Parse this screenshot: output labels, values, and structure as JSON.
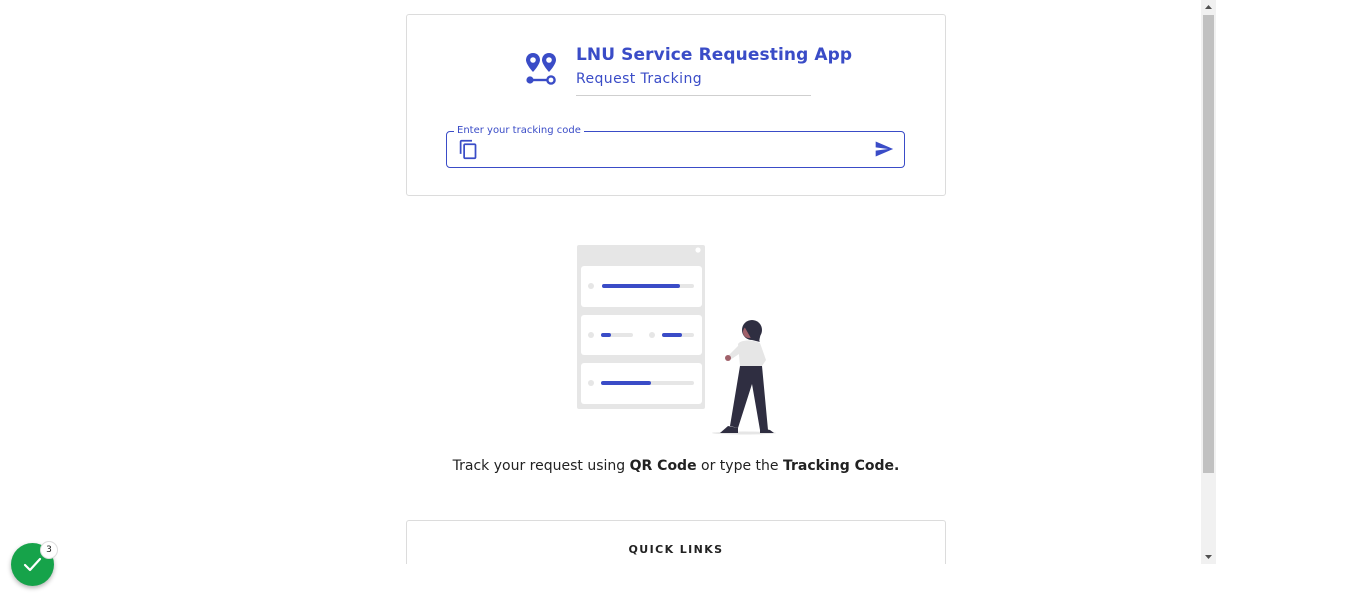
{
  "app": {
    "title": "LNU Service Requesting App",
    "subtitle": "Request Tracking"
  },
  "tracking": {
    "label": "Enter your tracking code",
    "value": "",
    "copy_icon": "content-copy-icon",
    "send_icon": "send-icon"
  },
  "hint": {
    "prefix": "Track your request using ",
    "qr": "QR Code",
    "middle": " or type the ",
    "code": "Tracking Code."
  },
  "quick_links": {
    "title": "QUICK LINKS"
  },
  "status_button": {
    "icon": "check-icon",
    "badge": "3"
  },
  "colors": {
    "accent": "#3a4cc7",
    "success": "#16a34a"
  }
}
